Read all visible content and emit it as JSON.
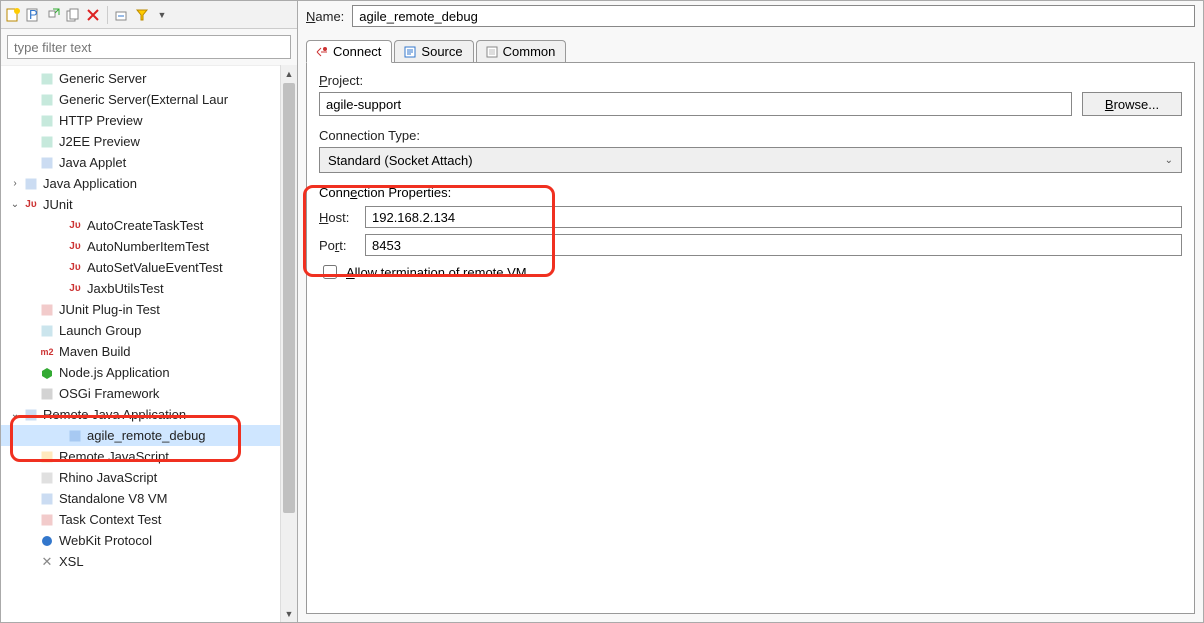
{
  "filter": {
    "placeholder": "type filter text"
  },
  "toolbarIcons": [
    "new-config",
    "new-prototype",
    "duplicate",
    "export",
    "delete",
    "collapse",
    "expand",
    "menu"
  ],
  "tree": [
    {
      "label": "Generic Server",
      "level": 1,
      "icon": "server-icon",
      "iconColor": "#2a7"
    },
    {
      "label": "Generic Server(External Laur",
      "level": 1,
      "icon": "server-icon",
      "iconColor": "#2a7"
    },
    {
      "label": "HTTP Preview",
      "level": 1,
      "icon": "server-icon",
      "iconColor": "#2a7"
    },
    {
      "label": "J2EE Preview",
      "level": 1,
      "icon": "server-icon",
      "iconColor": "#2a7"
    },
    {
      "label": "Java Applet",
      "level": 1,
      "icon": "applet-icon",
      "iconColor": "#37c"
    },
    {
      "label": "Java Application",
      "level": 0,
      "icon": "java-app-icon",
      "iconColor": "#37c",
      "twisty": ">"
    },
    {
      "label": "JUnit",
      "level": 0,
      "icon": "junit-icon",
      "iconColor": "#c33",
      "twisty": "v"
    },
    {
      "label": "AutoCreateTaskTest",
      "level": 1,
      "icon": "junit-icon",
      "iconColor": "#c33",
      "indent": 2
    },
    {
      "label": "AutoNumberItemTest",
      "level": 1,
      "icon": "junit-icon",
      "iconColor": "#c33",
      "indent": 2
    },
    {
      "label": "AutoSetValueEventTest",
      "level": 1,
      "icon": "junit-icon",
      "iconColor": "#c33",
      "indent": 2
    },
    {
      "label": "JaxbUtilsTest",
      "level": 1,
      "icon": "junit-icon",
      "iconColor": "#c33",
      "indent": 2
    },
    {
      "label": "JUnit Plug-in Test",
      "level": 1,
      "icon": "junit-plugin-icon",
      "iconColor": "#c33"
    },
    {
      "label": "Launch Group",
      "level": 1,
      "icon": "launch-group-icon",
      "iconColor": "#39b"
    },
    {
      "label": "Maven Build",
      "level": 1,
      "icon": "maven-icon",
      "iconColor": "#c33"
    },
    {
      "label": "Node.js Application",
      "level": 1,
      "icon": "node-icon",
      "iconColor": "#3a3"
    },
    {
      "label": "OSGi Framework",
      "level": 1,
      "icon": "osgi-icon",
      "iconColor": "#555"
    },
    {
      "label": "Remote Java Application",
      "level": 0,
      "icon": "remote-java-icon",
      "iconColor": "#37c",
      "twisty": "v"
    },
    {
      "label": "agile_remote_debug",
      "level": 1,
      "icon": "remote-java-icon",
      "iconColor": "#37c",
      "indent": 2,
      "selected": true
    },
    {
      "label": "Remote JavaScript",
      "level": 1,
      "icon": "remote-js-icon",
      "iconColor": "#fa0"
    },
    {
      "label": "Rhino JavaScript",
      "level": 1,
      "icon": "rhino-icon",
      "iconColor": "#888"
    },
    {
      "label": "Standalone V8 VM",
      "level": 1,
      "icon": "v8-icon",
      "iconColor": "#37c"
    },
    {
      "label": "Task Context Test",
      "level": 1,
      "icon": "task-icon",
      "iconColor": "#c33"
    },
    {
      "label": "WebKit Protocol",
      "level": 1,
      "icon": "webkit-icon",
      "iconColor": "#37c"
    },
    {
      "label": "XSL",
      "level": 1,
      "icon": "xsl-icon",
      "iconColor": "#888"
    }
  ],
  "name": {
    "label_prefix": "N",
    "label_rest": "ame:",
    "value": "agile_remote_debug"
  },
  "tabs": {
    "connect": "Connect",
    "source": "Source",
    "common": "Common"
  },
  "form": {
    "project_label_prefix": "P",
    "project_label_rest": "roject:",
    "project_value": "agile-support",
    "browse_prefix": "B",
    "browse_rest": "rowse...",
    "conn_type_label": "Connection Type:",
    "conn_type_value": "Standard (Socket Attach)",
    "conn_props_label_pre": "Conn",
    "conn_props_label_u": "e",
    "conn_props_label_post": "ction Properties:",
    "host_label_u": "H",
    "host_label_rest": "ost:",
    "host_value": "192.168.2.134",
    "port_label_pre": "Po",
    "port_label_u": "r",
    "port_label_post": "t:",
    "port_value": "8453",
    "allow_term_u": "A",
    "allow_term_rest": "llow termination of remote VM"
  }
}
